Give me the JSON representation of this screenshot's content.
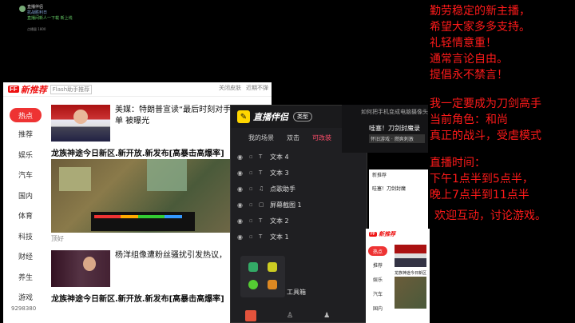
{
  "mini_window": {
    "title": "直播伴侣",
    "line2": "抗战胜利日",
    "line3": "直播间新人一下载 新上线",
    "footer": "点播量 1800"
  },
  "news": {
    "logo": "FF",
    "title": "新推荐",
    "tag": "Flash助手推荐",
    "header_links": [
      "关闭皮肤",
      "近期不弹"
    ],
    "sidebar": [
      "热点",
      "推荐",
      "娱乐",
      "汽车",
      "国内",
      "体育",
      "科技",
      "财经",
      "养生",
      "游戏"
    ],
    "headline": "美媒：特朗普宣读“最后时刻对手”的名单 被曝光",
    "article1": "龙族神途今日新区.新开放.新发布[高暴击高爆率]",
    "caption1": "顶好",
    "headline2": "杨洋组像遭粉丝骚扰引发热议，",
    "article2": "龙族神途今日新区.新开放.新发布[高暴击高爆率]",
    "counter": "9298380"
  },
  "live_companion": {
    "logo_glyph": "✎",
    "app_name": "直播伴侣",
    "type_label": "类型",
    "tabs": [
      "我的场景",
      "双击",
      "可改装"
    ],
    "selected_tab": "可改装",
    "sources": [
      {
        "label": "文本 4",
        "icon": "T"
      },
      {
        "label": "文本 3",
        "icon": "T"
      },
      {
        "label": "点歌助手",
        "icon": "♫"
      },
      {
        "label": "屏幕截图 1",
        "icon": "▢"
      },
      {
        "label": "文本 2",
        "icon": "T"
      },
      {
        "label": "文本 1",
        "icon": "T"
      }
    ],
    "tools_label": "工具箱"
  },
  "right_panel": {
    "link": "如何把手机变成电脑摄像头",
    "title": "哇塞！刀剑封魔录",
    "sub": "怀旧游戏 · 燃爽刺激"
  },
  "clip": {
    "header": "新推荐",
    "label": "哇塞！刀剑封魔"
  },
  "news2": {
    "logo": "FF",
    "title": "新推荐",
    "sidebar": [
      "热点",
      "推荐",
      "娱乐",
      "汽车",
      "国内"
    ],
    "caption": "龙族神途今日新区"
  },
  "overlay": {
    "lines_a": [
      "勤劳稳定的新主播，",
      "希望大家多多支持。",
      "礼轻情意重！",
      "通常言论自由。",
      "提倡永不禁言！"
    ],
    "lines_b": [
      "我一定要成为刀剑高手",
      "当前角色：和尚",
      "真正的战斗，受虐模式"
    ],
    "lines_c": [
      "直播时间：",
      "下午1点半到5点半，",
      "晚上7点半到11点半"
    ],
    "closing": "欢迎互动，讨论游戏。"
  },
  "colors": {
    "overlay_text": "#ff1a1a",
    "accent_red": "#e11",
    "companion_bg": "#1f1f22",
    "live_btn": "#e3533c",
    "selected_tab": "#ff4d6a"
  }
}
